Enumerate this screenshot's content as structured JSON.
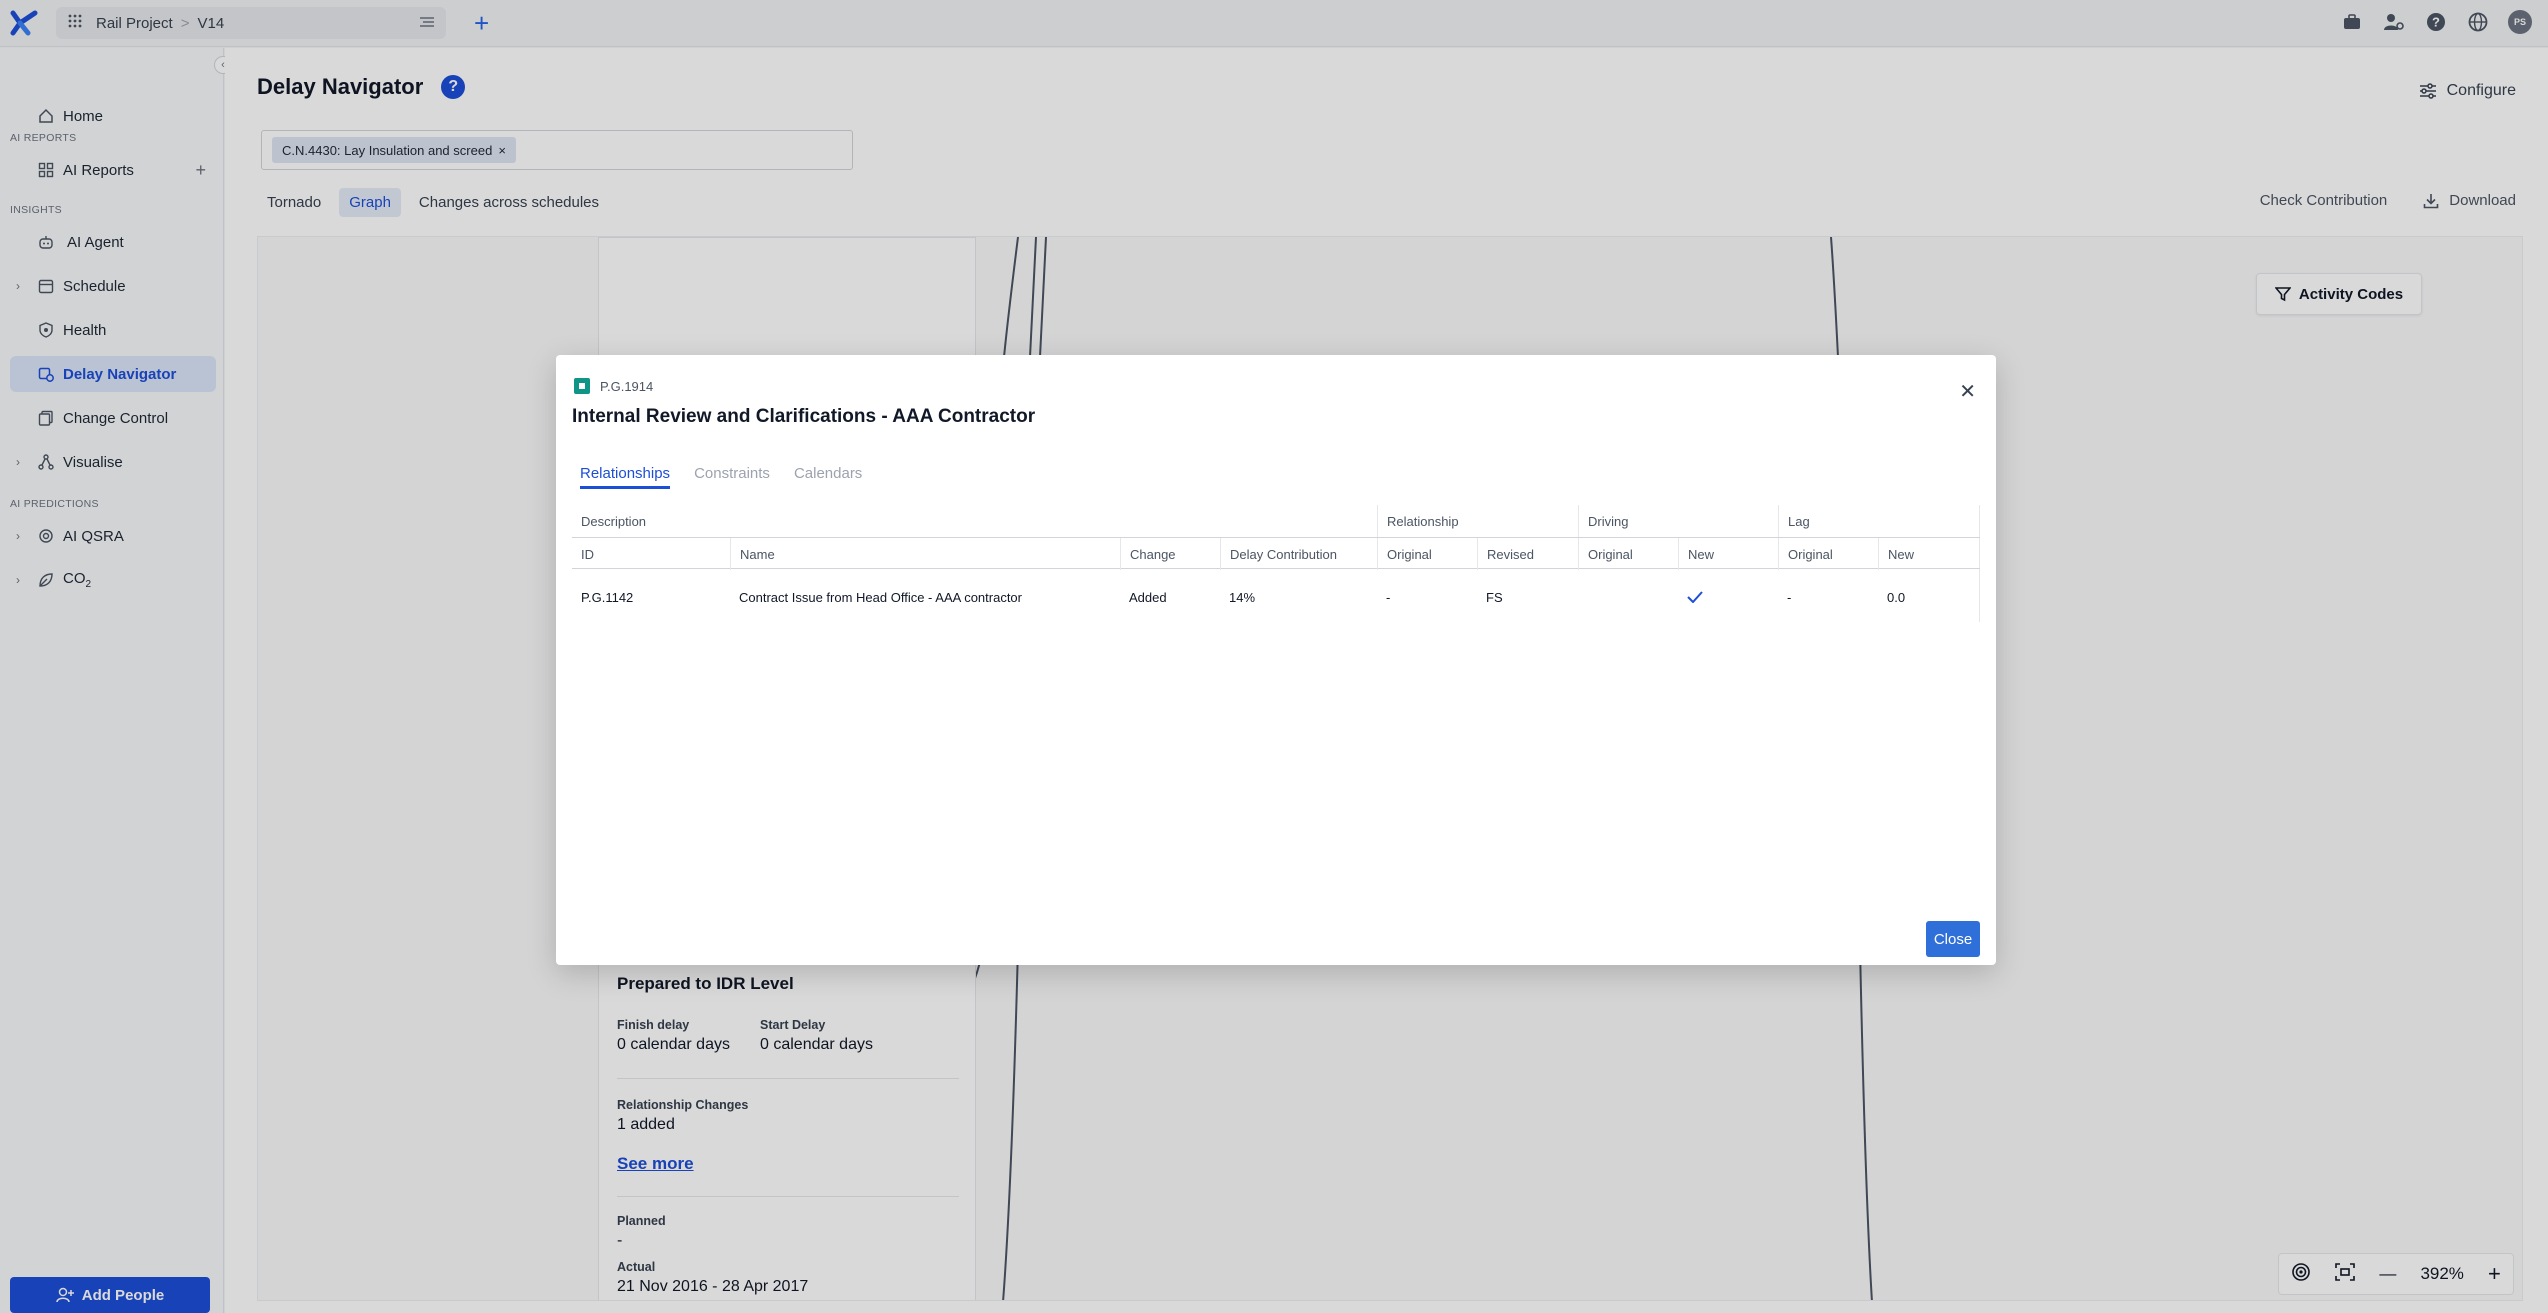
{
  "topbar": {
    "project_name": "Rail Project",
    "breadcrumb_separator": ">",
    "version": "V14",
    "avatar_initials": "PS",
    "icons": [
      "briefcase-icon",
      "user-settings-icon",
      "help-icon",
      "globe-icon"
    ]
  },
  "sidebar": {
    "items": {
      "home": "Home",
      "ai_reports": "AI Reports",
      "ai_agent": "AI Agent",
      "schedule": "Schedule",
      "health": "Health",
      "delay_navigator": "Delay Navigator",
      "change_control": "Change Control",
      "visualise": "Visualise",
      "ai_qsra": "AI QSRA",
      "co2": "CO",
      "co2_sub": "2"
    },
    "sections": {
      "ai_reports": "AI REPORTS",
      "insights": "INSIGHTS",
      "ai_predictions": "AI PREDICTIONS"
    },
    "add_people": "Add People"
  },
  "main": {
    "title": "Delay Navigator",
    "configure": "Configure",
    "filter_chip": "C.N.4430: Lay Insulation and screed",
    "tabs": [
      "Tornado",
      "Graph",
      "Changes across schedules"
    ],
    "selected_tab": "Graph",
    "check_contribution": "Check Contribution",
    "download": "Download",
    "activity_codes": "Activity Codes",
    "card": {
      "heading": "Prepared to IDR Level",
      "finish_delay_label": "Finish delay",
      "finish_delay_value": "0 calendar days",
      "start_delay_label": "Start Delay",
      "start_delay_value": "0 calendar days",
      "rel_changes_label": "Relationship Changes",
      "rel_changes_value": "1 added",
      "see_more": "See more",
      "planned_label": "Planned",
      "planned_value": "-",
      "actual_label": "Actual",
      "actual_value": "21 Nov 2016 - 28 Apr 2017"
    },
    "zoom_level": "392%"
  },
  "modal": {
    "activity_id": "P.G.1914",
    "title": "Internal Review and Clarifications - AAA Contractor",
    "tabs": [
      "Relationships",
      "Constraints",
      "Calendars"
    ],
    "selected_tab": "Relationships",
    "group_headers": {
      "description": "Description",
      "relationship": "Relationship",
      "driving": "Driving",
      "lag": "Lag"
    },
    "columns": {
      "id": "ID",
      "name": "Name",
      "change": "Change",
      "delay_contribution": "Delay Contribution",
      "rel_original": "Original",
      "rel_revised": "Revised",
      "driving_original": "Original",
      "driving_new": "New",
      "lag_original": "Original",
      "lag_new": "New"
    },
    "rows": [
      {
        "id": "P.G.1142",
        "name": "Contract Issue from Head Office - AAA contractor",
        "change": "Added",
        "delay_contribution": "14%",
        "rel_original": "-",
        "rel_revised": "FS",
        "driving_original": "",
        "driving_new_checked": true,
        "lag_original": "-",
        "lag_new": "0.0"
      }
    ],
    "close_button": "Close"
  },
  "colors": {
    "primary": "#1d4ed8",
    "teal_badge": "#0f9488",
    "active_nav_bg": "#dbe6f8"
  }
}
